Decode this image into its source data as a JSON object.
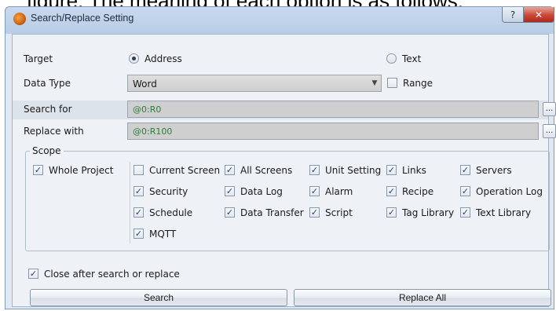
{
  "caption": "figure. The meaning of each option is as follows:",
  "window": {
    "title": "Search/Replace Setting",
    "help_label": "?",
    "close_label": "✕"
  },
  "target": {
    "label": "Target",
    "options": [
      "Address",
      "Text"
    ],
    "selected": "Address"
  },
  "data_type": {
    "label": "Data Type",
    "value": "Word",
    "range_label": "Range",
    "range_checked": false
  },
  "search_for": {
    "label": "Search for",
    "value": "@0:R0",
    "browse_label": "..."
  },
  "replace_with": {
    "label": "Replace with",
    "value": "@0:R100",
    "browse_label": "..."
  },
  "scope": {
    "title": "Scope",
    "whole_project": {
      "label": "Whole Project",
      "checked": true
    },
    "items": [
      {
        "label": "Current Screen",
        "checked": false
      },
      {
        "label": "All Screens",
        "checked": true
      },
      {
        "label": "Unit Setting",
        "checked": true
      },
      {
        "label": "Links",
        "checked": true
      },
      {
        "label": "Servers",
        "checked": true
      },
      {
        "label": "Security",
        "checked": true
      },
      {
        "label": "Data Log",
        "checked": true
      },
      {
        "label": "Alarm",
        "checked": true
      },
      {
        "label": "Recipe",
        "checked": true
      },
      {
        "label": "Operation Log",
        "checked": true
      },
      {
        "label": "Schedule",
        "checked": true
      },
      {
        "label": "Data Transfer",
        "checked": true
      },
      {
        "label": "Script",
        "checked": true
      },
      {
        "label": "Tag Library",
        "checked": true
      },
      {
        "label": "Text Library",
        "checked": true
      },
      {
        "label": "MQTT",
        "checked": true
      }
    ]
  },
  "close_after": {
    "label": "Close after search or replace",
    "checked": true
  },
  "buttons": {
    "search": "Search",
    "replace_all": "Replace All"
  },
  "check_glyph": "✓"
}
